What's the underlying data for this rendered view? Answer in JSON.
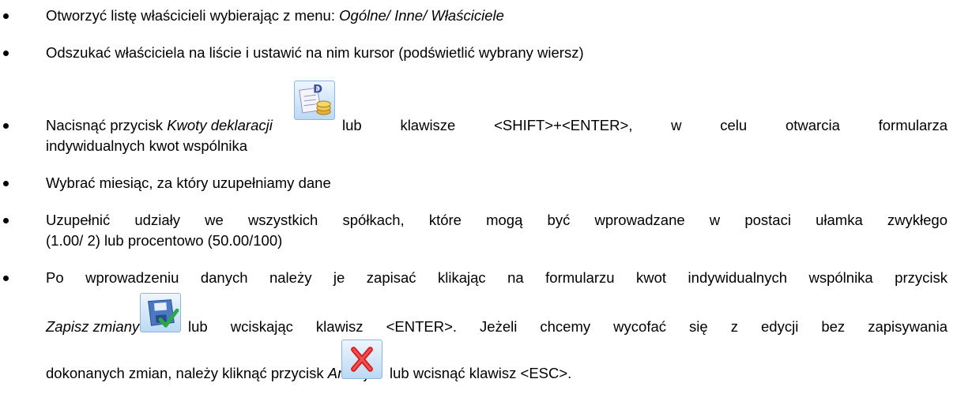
{
  "steps": [
    {
      "pre": "Otworzyć listę właścicieli wybierając z menu: ",
      "em": "Ogólne/ Inne/ Właściciele"
    },
    {
      "text": "Odszukać właściciela na liście i ustawić na nim kursor (podświetlić wybrany wiersz)"
    },
    {
      "pre": "Nacisnąć przycisk ",
      "em": "Kwoty deklaracji",
      "post": "lub klawisze <SHIFT>+<ENTER>, w celu otwarcia formularza",
      "line2": "indywidualnych kwot wspólnika",
      "icon": "declaration-amounts-icon"
    },
    {
      "text": "Wybrać miesiąc, za który uzupełniamy dane"
    },
    {
      "line1": "Uzupełnić udziały we wszystkich spółkach, które mogą być wprowadzane w postaci ułamka zwykłego",
      "line2": "(1.00/ 2) lub procentowo (50.00/100)"
    },
    {
      "line1": "Po wprowadzeniu danych należy je zapisać klikając na formularzu kwot indywidualnych wspólnika przycisk",
      "em2": "Zapisz zmiany",
      "post2": "lub wciskając klawisz <ENTER>. Jeżeli chcemy wycofać się z edycji bez zapisywania",
      "pre3": "dokonanych zmian, należy kliknąć przycisk ",
      "em3": "Anuluj",
      "post3": "lub wcisnąć klawisz <ESC>.",
      "icon_save": "save-changes-icon",
      "icon_cancel": "cancel-icon"
    }
  ]
}
